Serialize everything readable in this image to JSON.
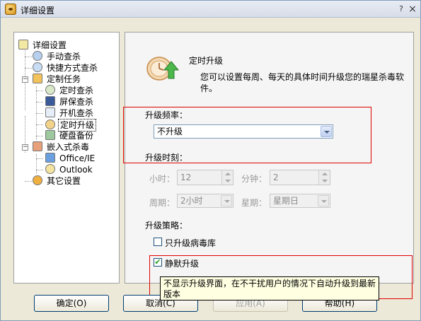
{
  "window": {
    "title": "详细设置"
  },
  "tree": {
    "items": [
      {
        "label": "详细设置"
      },
      {
        "label": "手动查杀"
      },
      {
        "label": "快捷方式查杀"
      },
      {
        "label": "定制任务"
      },
      {
        "label": "定时查杀"
      },
      {
        "label": "屏保查杀"
      },
      {
        "label": "开机查杀"
      },
      {
        "label": "定时升级"
      },
      {
        "label": "硬盘备份"
      },
      {
        "label": "嵌入式杀毒"
      },
      {
        "label": "Office/IE"
      },
      {
        "label": "Outlook"
      },
      {
        "label": "其它设置"
      }
    ],
    "expanders": {
      "custom_tasks": "−",
      "embedded": "−"
    }
  },
  "section": {
    "title": "定时升级",
    "description": "您可以设置每周、每天的具体时间升级您的瑞星杀毒软件。"
  },
  "form": {
    "frequency_label": "升级频率：",
    "frequency_value": "不升级",
    "time_label": "升级时刻：",
    "hour_label": "小时：",
    "hour_value": "12",
    "minute_label": "分钟：",
    "minute_value": "2",
    "period_label": "周期：",
    "period_value": "2小时",
    "weekday_label": "星期：",
    "weekday_value": "星期日",
    "strategy_label": "升级策略：",
    "virus_db_only_label": "只升级病毒库",
    "virus_db_only_checked": false,
    "silent_label": "静默升级",
    "silent_checked": true,
    "check_mark": "✔"
  },
  "tooltip": {
    "text": "不显示升级界面，在不干扰用户的情况下自动升级到最新版本"
  },
  "buttons": {
    "ok": "确定(O)",
    "cancel": "取消(C)",
    "apply": "应用(A)",
    "help": "帮助(H)"
  },
  "titlebar": {
    "help_glyph": "?",
    "close_glyph": "×"
  },
  "icons": {
    "app": "rising-lion-icon",
    "upgrade": "scheduled-upgrade-icon"
  },
  "colors": {
    "highlight_box": "#e00000",
    "tooltip_bg": "#ffffe1"
  }
}
